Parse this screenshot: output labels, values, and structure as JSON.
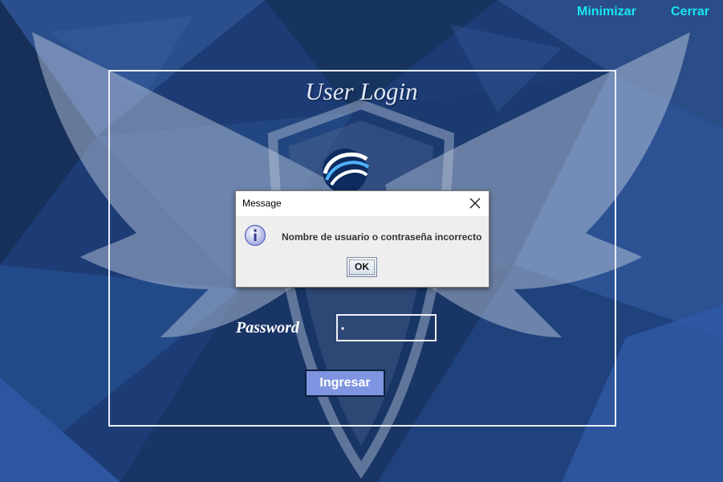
{
  "window": {
    "minimize_label": "Minimizar",
    "close_label": "Cerrar"
  },
  "login": {
    "title": "User Login",
    "password_label": "Password",
    "password_mask": "•",
    "submit_label": "Ingresar"
  },
  "dialog": {
    "title": "Message",
    "message": "Nombre de usuario o contraseña incorrecto",
    "ok_label": "OK",
    "icon": "info-icon"
  },
  "colors": {
    "accent_links": "#19e6f0",
    "background": "#1f3f7a",
    "button": "#7f95e1"
  }
}
